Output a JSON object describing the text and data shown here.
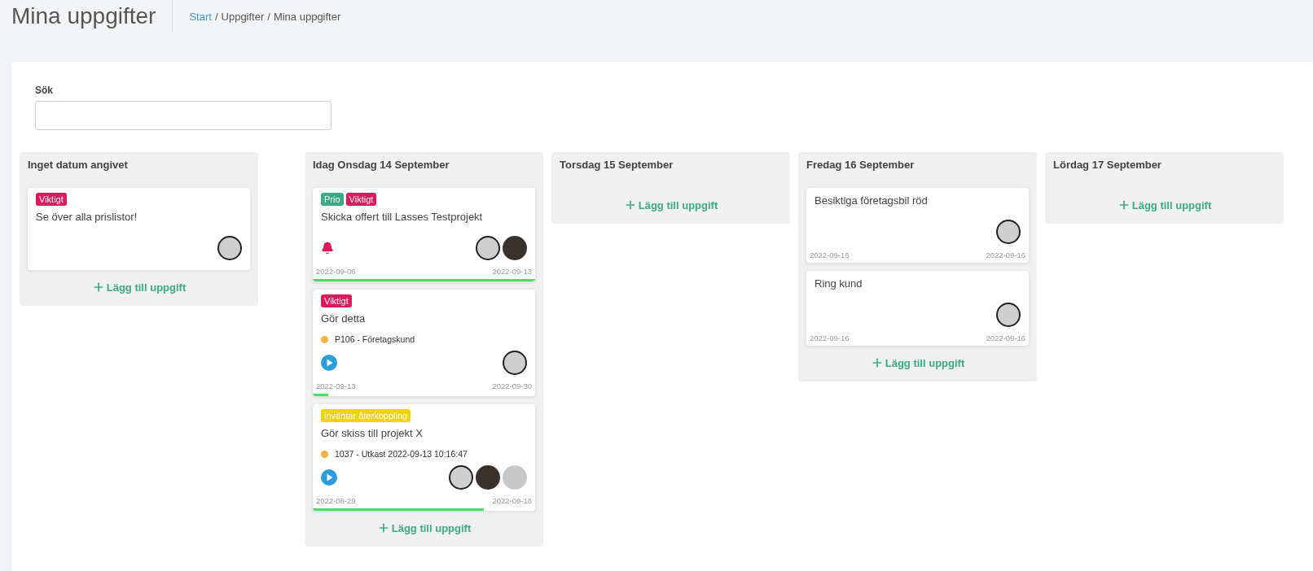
{
  "page_title": "Mina uppgifter",
  "breadcrumb": {
    "separator": "/",
    "items": [
      {
        "label": "Start",
        "link": true
      },
      {
        "label": "Uppgifter",
        "link": false
      },
      {
        "label": "Mina uppgifter",
        "link": false
      }
    ]
  },
  "search": {
    "label": "Sök"
  },
  "columns": [
    {
      "title": "Inget datum angivet",
      "add_label": "Lägg till uppgift",
      "tasks": [
        {
          "tags": [
            {
              "label": "Viktigt",
              "color": "#e0195f"
            }
          ],
          "title": "Se över alla prislistor!",
          "avatars": [
            {
              "kind": "outlined"
            }
          ]
        }
      ]
    },
    {
      "title": "Idag Onsdag 14 September",
      "add_label": "Lägg till uppgift",
      "tasks": [
        {
          "tags": [
            {
              "label": "Prio",
              "color": "#3aaa85"
            },
            {
              "label": "Viktigt",
              "color": "#e0195f"
            }
          ],
          "title": "Skicka offert till Lasses Testprojekt",
          "kind": "reminder",
          "avatars": [
            {
              "kind": "outlined"
            },
            {
              "kind": "dark"
            }
          ],
          "start": "2022-09-06",
          "end": "2022-09-13",
          "level": 1
        },
        {
          "tags": [
            {
              "label": "Viktigt",
              "color": "#e0195f"
            }
          ],
          "title": "Gör detta",
          "project": {
            "label": "P106 - Företagskund",
            "color": "#fbb13c"
          },
          "kind": "timer",
          "avatars": [
            {
              "kind": "outlined"
            }
          ],
          "start": "2022-09-13",
          "end": "2022-09-30",
          "level": 0.07
        },
        {
          "tags": [
            {
              "label": "inväntar återkoppling",
              "color": "#f0d400"
            }
          ],
          "title": "Gör skiss till projekt X",
          "project": {
            "label": "1037 - Utkast 2022-09-13 10:16:47",
            "color": "#fbb13c"
          },
          "kind": "timer",
          "avatars": [
            {
              "kind": "outlined"
            },
            {
              "kind": "dark"
            },
            {
              "kind": "light"
            }
          ],
          "start": "2022-08-29",
          "end": "2022-09-18",
          "level": 0.77
        }
      ]
    },
    {
      "title": "Torsdag 15 September",
      "add_label": "Lägg till uppgift"
    },
    {
      "title": "Fredag 16 September",
      "add_label": "Lägg till uppgift",
      "tasks": [
        {
          "title": "Besiktiga företagsbil röd",
          "avatars": [
            {
              "kind": "outlined"
            }
          ],
          "start": "2022-09-16",
          "end": "2022-09-16"
        },
        {
          "title": "Ring kund",
          "avatars": [
            {
              "kind": "outlined"
            }
          ],
          "start": "2022-09-16",
          "end": "2022-09-16"
        }
      ]
    },
    {
      "title": "Lördag 17 September",
      "add_label": "Lägg till uppgift"
    }
  ]
}
